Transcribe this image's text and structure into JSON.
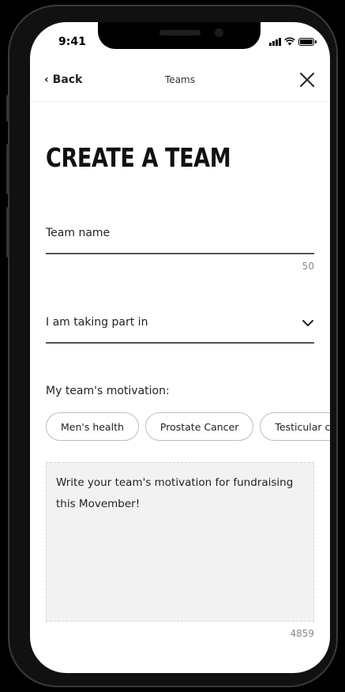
{
  "status_bar": {
    "time": "9:41"
  },
  "nav": {
    "back_label": "‹ Back",
    "title": "Teams"
  },
  "page": {
    "title": "CREATE A TEAM"
  },
  "team_name": {
    "label": "Team name",
    "counter": "50"
  },
  "participation": {
    "label": "I am taking part in"
  },
  "motivation": {
    "label": "My team's motivation:",
    "chips": [
      "Men's health",
      "Prostate Cancer",
      "Testicular cancer"
    ],
    "placeholder": "Write your team's motivation for fundraising this Movember!",
    "counter": "4859"
  }
}
